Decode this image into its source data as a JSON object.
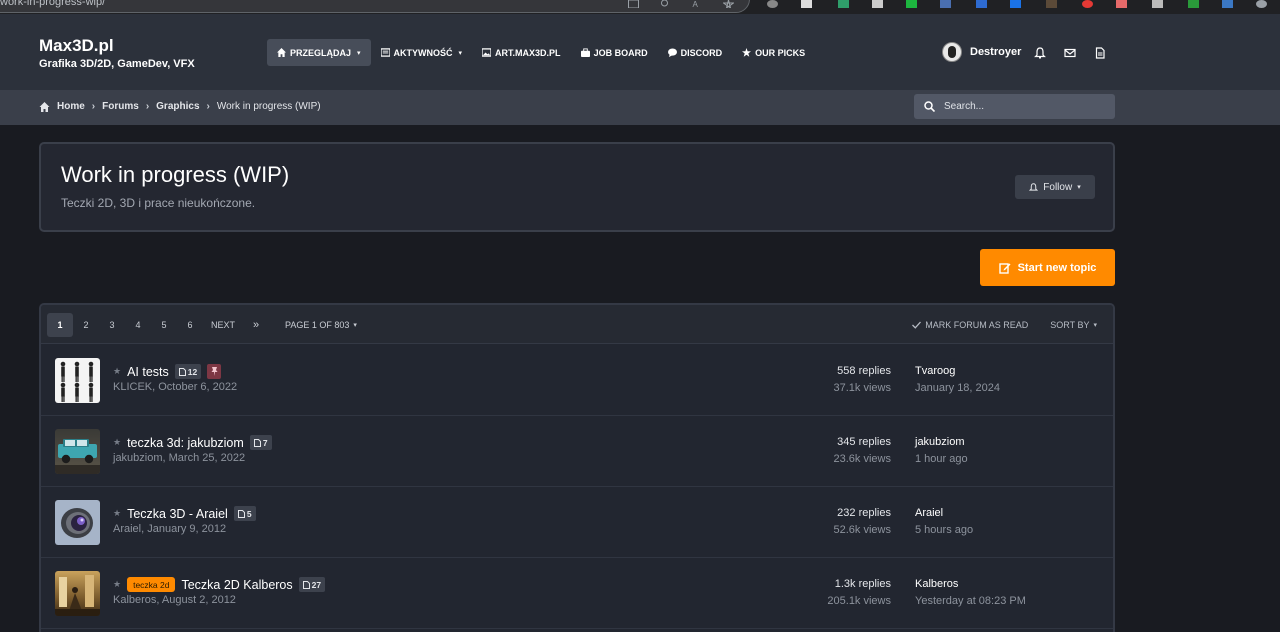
{
  "browser": {
    "url": "work-in-progress-wip/"
  },
  "header": {
    "brand": "Max3D.pl",
    "tagline": "Grafika 3D/2D, GameDev, VFX",
    "nav": [
      {
        "label": "Przeglądaj",
        "icon": "home-icon",
        "caret": true,
        "active": true
      },
      {
        "label": "Aktywność",
        "icon": "list-icon",
        "caret": true,
        "active": false
      },
      {
        "label": "ART.MAX3D.PL",
        "icon": "image-icon",
        "caret": false,
        "active": false
      },
      {
        "label": "Job Board",
        "icon": "briefcase-icon",
        "caret": false,
        "active": false
      },
      {
        "label": "Discord",
        "icon": "chat-icon",
        "caret": false,
        "active": false
      },
      {
        "label": "Our Picks",
        "icon": "star-icon",
        "caret": false,
        "active": false
      }
    ],
    "username": "Destroyer"
  },
  "breadcrumb": {
    "items": [
      "Home",
      "Forums",
      "Graphics"
    ],
    "current": "Work in progress (WIP)"
  },
  "search": {
    "placeholder": "Search..."
  },
  "forum": {
    "title": "Work in progress (WIP)",
    "description": "Teczki 2D, 3D i prace nieukończone.",
    "follow_label": "Follow"
  },
  "start_topic_label": "Start new topic",
  "pagination": {
    "pages": [
      "1",
      "2",
      "3",
      "4",
      "5",
      "6"
    ],
    "active": "1",
    "next_label": "Next",
    "last_label": "»",
    "page_of": "Page 1 of 803",
    "mark_read": "Mark forum as read",
    "sort_by": "Sort By"
  },
  "topics": [
    {
      "title": "AI tests",
      "tag": "",
      "pages": "12",
      "pinned": true,
      "author_date": "KLICEK, October 6, 2022",
      "replies": "558 replies",
      "views": "37.1k views",
      "last_user": "Tvaroog",
      "last_date": "January 18, 2024"
    },
    {
      "title": "teczka 3d: jakubziom",
      "tag": "",
      "pages": "7",
      "pinned": false,
      "author_date": "jakubziom, March 25, 2022",
      "replies": "345 replies",
      "views": "23.6k views",
      "last_user": "jakubziom",
      "last_date": "1 hour ago"
    },
    {
      "title": "Teczka 3D - Araiel",
      "tag": "",
      "pages": "5",
      "pinned": false,
      "author_date": "Araiel, January 9, 2012",
      "replies": "232 replies",
      "views": "52.6k views",
      "last_user": "Araiel",
      "last_date": "5 hours ago"
    },
    {
      "title": "Teczka 2D Kalberos",
      "tag": "teczka 2d",
      "pages": "27",
      "pinned": false,
      "author_date": "Kalberos, August 2, 2012",
      "replies": "1.3k replies",
      "views": "205.1k views",
      "last_user": "Kalberos",
      "last_date": "Yesterday at 08:23 PM"
    }
  ],
  "colors": {
    "accent": "#ff8a00",
    "header": "#2c313b",
    "background": "#191b21",
    "pinned": "#7d3744"
  }
}
